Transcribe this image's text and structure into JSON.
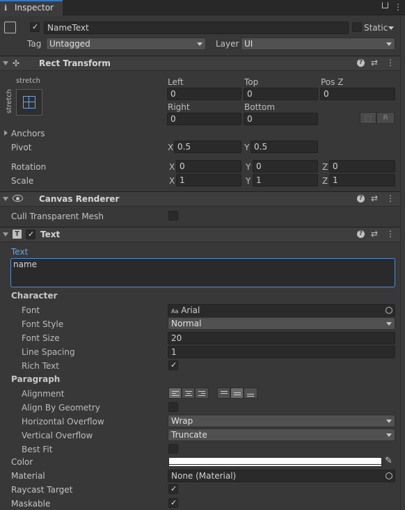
{
  "tab": {
    "label": "Inspector"
  },
  "object": {
    "name": "NameText",
    "static_label": "Static",
    "tag_label": "Tag",
    "tag_value": "Untagged",
    "layer_label": "Layer",
    "layer_value": "UI"
  },
  "rect_transform": {
    "title": "Rect Transform",
    "anchor_preset_top": "stretch",
    "anchor_preset_side": "stretch",
    "left_label": "Left",
    "left_value": "0",
    "top_label": "Top",
    "top_value": "0",
    "posz_label": "Pos Z",
    "posz_value": "0",
    "right_label": "Right",
    "right_value": "0",
    "bottom_label": "Bottom",
    "bottom_value": "0",
    "blueprint_btn": "⬚",
    "raw_btn": "R",
    "anchors_label": "Anchors",
    "pivot_label": "Pivot",
    "pivot_x": "0.5",
    "pivot_y": "0.5",
    "rotation_label": "Rotation",
    "rot_x": "0",
    "rot_y": "0",
    "rot_z": "0",
    "scale_label": "Scale",
    "scale_x": "1",
    "scale_y": "1",
    "scale_z": "1",
    "axis_x": "X",
    "axis_y": "Y",
    "axis_z": "Z"
  },
  "canvas_renderer": {
    "title": "Canvas Renderer",
    "cull_label": "Cull Transparent Mesh"
  },
  "text_component": {
    "title": "Text",
    "text_label": "Text",
    "text_value": "name",
    "character_label": "Character",
    "font_label": "Font",
    "font_value": "Arial",
    "font_icon_text": "Aa",
    "font_style_label": "Font Style",
    "font_style_value": "Normal",
    "font_size_label": "Font Size",
    "font_size_value": "20",
    "line_spacing_label": "Line Spacing",
    "line_spacing_value": "1",
    "rich_text_label": "Rich Text",
    "paragraph_label": "Paragraph",
    "alignment_label": "Alignment",
    "align_geometry_label": "Align By Geometry",
    "h_overflow_label": "Horizontal Overflow",
    "h_overflow_value": "Wrap",
    "v_overflow_label": "Vertical Overflow",
    "v_overflow_value": "Truncate",
    "best_fit_label": "Best Fit",
    "color_label": "Color",
    "material_label": "Material",
    "material_value": "None (Material)",
    "raycast_label": "Raycast Target",
    "maskable_label": "Maskable"
  },
  "icons": {
    "check": "✓",
    "help": "?",
    "settings": "⇄",
    "more": "⋮",
    "lock": "🔒",
    "menu": "≡"
  },
  "colors": {
    "background": "#383838",
    "field": "#2a2a2a",
    "accent": "#4d90d6",
    "color_swatch": "#ffffff"
  }
}
